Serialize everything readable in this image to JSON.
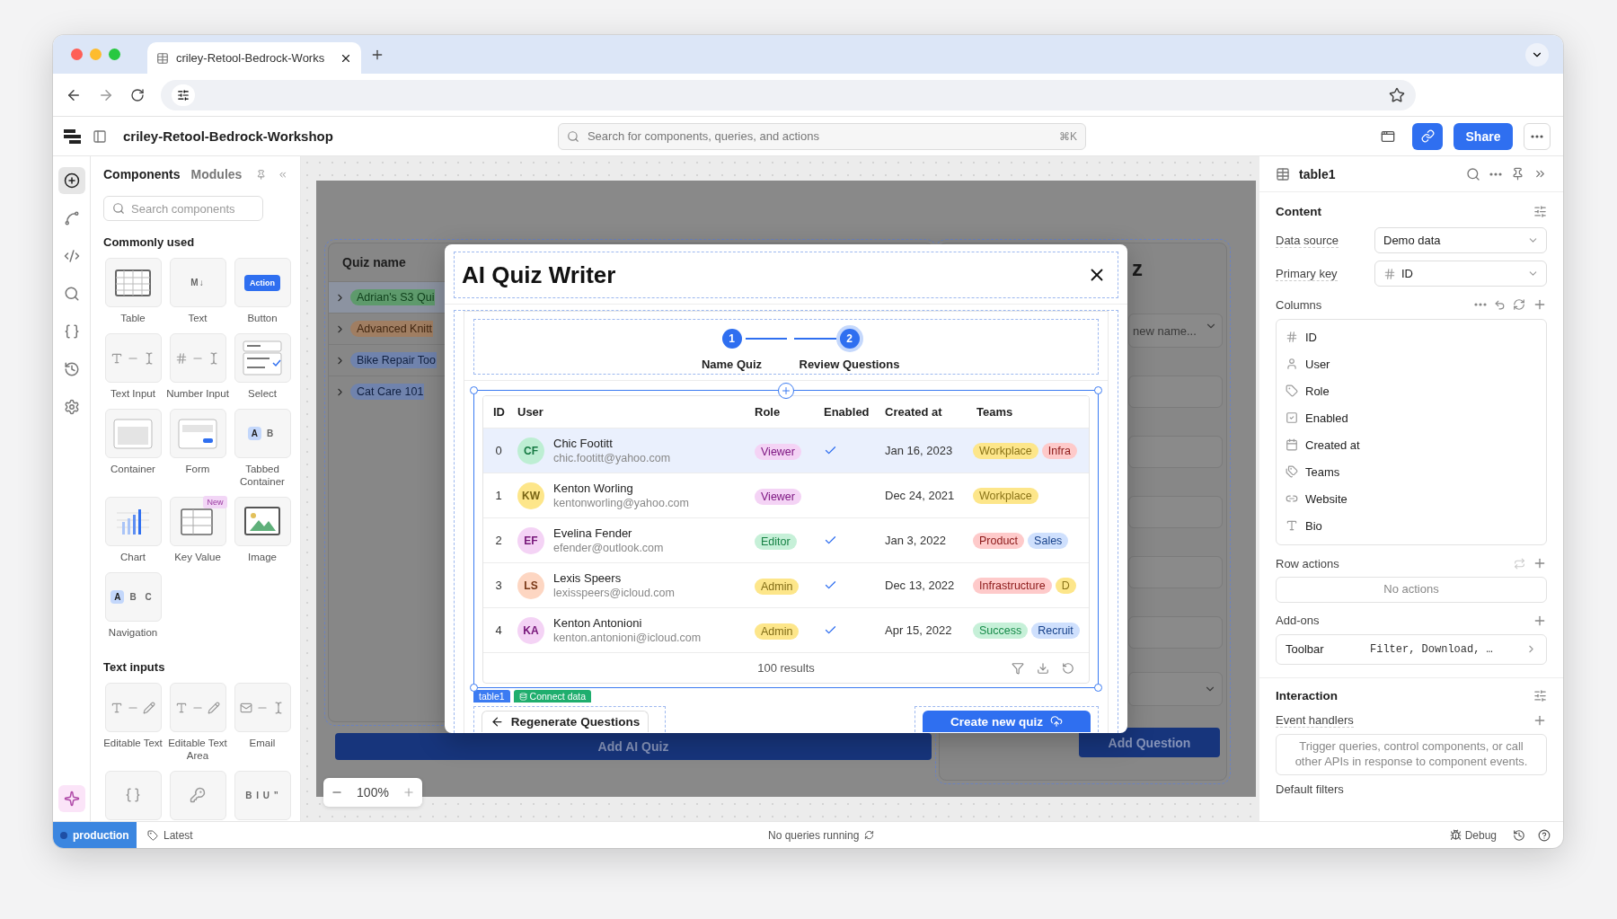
{
  "browser": {
    "tab_title": "criley-Retool-Bedrock-Works"
  },
  "app": {
    "title": "criley-Retool-Bedrock-Workshop",
    "search": {
      "placeholder": "Search for components, queries, and actions",
      "shortcut": "⌘K"
    },
    "share": "Share"
  },
  "rail": {
    "items": [
      {
        "selected": true
      },
      {
        "selected": false
      },
      {
        "selected": false
      },
      {
        "selected": false
      },
      {
        "selected": false
      },
      {
        "selected": false
      },
      {
        "selected": false
      }
    ]
  },
  "left_panel": {
    "tabs": [
      {
        "label": "Components",
        "selected": true
      },
      {
        "label": "Modules",
        "selected": false
      }
    ],
    "search": {
      "placeholder": "Search components"
    },
    "sections": [
      {
        "title": "Commonly used",
        "items": [
          {
            "label": "Table",
            "kind": "table"
          },
          {
            "label": "Text",
            "kind": "text",
            "preview_text": "M↓"
          },
          {
            "label": "Button",
            "kind": "button",
            "preview_text": "Action"
          },
          {
            "label": "Text Input",
            "kind": "text_input"
          },
          {
            "label": "Number Input",
            "kind": "number_input"
          },
          {
            "label": "Select",
            "kind": "select"
          },
          {
            "label": "Container",
            "kind": "container"
          },
          {
            "label": "Form",
            "kind": "form"
          },
          {
            "label": "Tabbed Container",
            "kind": "tabbed",
            "preview": [
              {
                "text": "A",
                "selected": true
              },
              {
                "text": "B",
                "selected": false
              }
            ]
          },
          {
            "label": "Chart",
            "kind": "chart"
          },
          {
            "label": "Key Value",
            "kind": "key_value",
            "badge": "New"
          },
          {
            "label": "Image",
            "kind": "image"
          },
          {
            "label": "Navigation",
            "kind": "navigation",
            "preview": [
              {
                "text": "A",
                "selected": true
              },
              {
                "text": "B",
                "selected": false
              },
              {
                "text": "C",
                "selected": false
              }
            ]
          }
        ]
      },
      {
        "title": "Text inputs",
        "items": [
          {
            "label": "Editable Text",
            "kind": "editable_text"
          },
          {
            "label": "Editable Text Area",
            "kind": "editable_area"
          },
          {
            "label": "Email",
            "kind": "email"
          },
          {
            "kind": "json"
          },
          {
            "kind": "password"
          },
          {
            "kind": "rich_text",
            "preview_text": "B I U ”"
          }
        ]
      }
    ]
  },
  "canvas": {
    "quiz_list": {
      "header": "Quiz name",
      "rows": [
        {
          "label": "Adrian's S3 Qui",
          "color": "#5e9a6c",
          "selected": true
        },
        {
          "label": "Advanced Knitt",
          "color": "#a07e62",
          "selected": false
        },
        {
          "label": "Bike Repair Too",
          "color": "#7083ad",
          "selected": false
        },
        {
          "label": "Cat Care 101",
          "color": "#7083ad",
          "selected": false
        }
      ]
    },
    "add_ai_quiz": "Add AI Quiz",
    "side_form": {
      "title": "z",
      "select_placeholder": "new name...",
      "add_question": "Add Question"
    },
    "zoom": "100%"
  },
  "modal": {
    "title": "AI Quiz Writer",
    "steps": [
      {
        "number": "1",
        "label": "Name Quiz",
        "selected": false
      },
      {
        "number": "2",
        "label": "Review Questions",
        "selected": true
      }
    ],
    "table": {
      "name": "table1",
      "connect": "Connect data",
      "columns": [
        "ID",
        "User",
        "Role",
        "Enabled",
        "Created at",
        "Teams"
      ],
      "rows": [
        {
          "id": "0",
          "avatar": {
            "initials": "CF",
            "color": "#bdeed3"
          },
          "name": "Chic Footitt",
          "email": "chic.footitt@yahoo.com",
          "role": {
            "label": "Viewer",
            "color": "#f4d3f5"
          },
          "enabled": true,
          "created": "Jan 16, 2023",
          "teams": [
            {
              "label": "Workplace",
              "color": "#fde68a"
            },
            {
              "label": "Infra",
              "color": "#fecaca"
            }
          ],
          "selected": true
        },
        {
          "id": "1",
          "avatar": {
            "initials": "KW",
            "color": "#fde68a"
          },
          "name": "Kenton Worling",
          "email": "kentonworling@yahoo.com",
          "role": {
            "label": "Viewer",
            "color": "#f4d3f5"
          },
          "enabled": false,
          "created": "Dec 24, 2021",
          "teams": [
            {
              "label": "Workplace",
              "color": "#fde68a"
            }
          ],
          "selected": false
        },
        {
          "id": "2",
          "avatar": {
            "initials": "EF",
            "color": "#f4d3f5"
          },
          "name": "Evelina Fender",
          "email": "efender@outlook.com",
          "role": {
            "label": "Editor",
            "color": "#c6f0d8"
          },
          "enabled": true,
          "created": "Jan 3, 2022",
          "teams": [
            {
              "label": "Product",
              "color": "#fecaca"
            },
            {
              "label": "Sales",
              "color": "#cfe0fd"
            }
          ],
          "selected": false
        },
        {
          "id": "3",
          "avatar": {
            "initials": "LS",
            "color": "#fdd6c2"
          },
          "name": "Lexis Speers",
          "email": "lexisspeers@icloud.com",
          "role": {
            "label": "Admin",
            "color": "#fde68a"
          },
          "enabled": true,
          "created": "Dec 13, 2022",
          "teams": [
            {
              "label": "Infrastructure",
              "color": "#fecaca"
            },
            {
              "label": "D",
              "color": "#fde68a"
            }
          ],
          "selected": false
        },
        {
          "id": "4",
          "avatar": {
            "initials": "KA",
            "color": "#f4d3f5"
          },
          "name": "Kenton Antonioni",
          "email": "kenton.antonioni@icloud.com",
          "role": {
            "label": "Admin",
            "color": "#fde68a"
          },
          "enabled": true,
          "created": "Apr 15, 2022",
          "teams": [
            {
              "label": "Success",
              "color": "#c6f0d8"
            },
            {
              "label": "Recruit",
              "color": "#cfe0fd"
            }
          ],
          "selected": false
        }
      ],
      "footer": "100 results"
    },
    "buttons": [
      {
        "label": "Regenerate Questions",
        "kind": "secondary"
      },
      {
        "label": "Create new quiz",
        "kind": "primary"
      }
    ]
  },
  "inspector": {
    "title": "table1",
    "content": {
      "title": "Content",
      "data_source": {
        "label": "Data source",
        "value": "Demo data"
      },
      "primary_key": {
        "label": "Primary key",
        "value": "ID"
      },
      "columns": {
        "label": "Columns",
        "items": [
          {
            "label": "ID",
            "kind": "number"
          },
          {
            "label": "User",
            "kind": "user"
          },
          {
            "label": "Role",
            "kind": "tag"
          },
          {
            "label": "Enabled",
            "kind": "boolean"
          },
          {
            "label": "Created at",
            "kind": "date"
          },
          {
            "label": "Teams",
            "kind": "tags"
          },
          {
            "label": "Website",
            "kind": "link"
          },
          {
            "label": "Bio",
            "kind": "text"
          }
        ]
      },
      "row_actions": {
        "label": "Row actions",
        "empty": "No actions"
      },
      "addons": {
        "label": "Add-ons",
        "items": [
          {
            "name": "Toolbar",
            "value": "Filter, Download, …"
          }
        ]
      }
    },
    "interaction": {
      "title": "Interaction",
      "event_handlers": {
        "label": "Event handlers",
        "empty": "Trigger queries, control components, or call other APIs in response to component events."
      },
      "default_filters": "Default filters"
    }
  },
  "status_bar": {
    "environment": "production",
    "version": "Latest",
    "queries": "No queries running",
    "debug": "Debug"
  }
}
